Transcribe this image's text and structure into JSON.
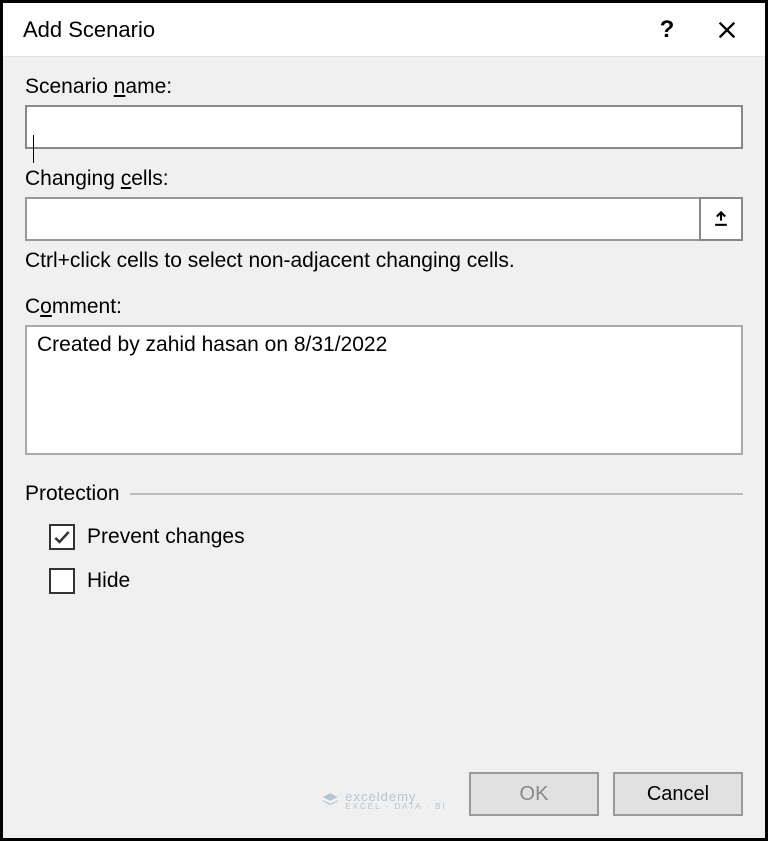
{
  "titlebar": {
    "title": "Add Scenario",
    "help_label": "?"
  },
  "fields": {
    "scenario_name": {
      "label_prefix": "Scenario ",
      "label_ul": "n",
      "label_suffix": "ame:",
      "value": ""
    },
    "changing_cells": {
      "label_prefix": "Changing ",
      "label_ul": "c",
      "label_suffix": "ells:",
      "value": "",
      "hint": "Ctrl+click cells to select non-adjacent changing cells."
    },
    "comment": {
      "label_prefix": "C",
      "label_ul": "o",
      "label_suffix": "mment:",
      "value": "Created by zahid hasan on 8/31/2022"
    }
  },
  "protection": {
    "legend": "Protection",
    "prevent": {
      "checked": true,
      "label_ul": "P",
      "label_suffix": "revent changes"
    },
    "hide": {
      "checked": false,
      "label_prefix": "Hi",
      "label_ul": "d",
      "label_suffix": "e"
    }
  },
  "buttons": {
    "ok": "OK",
    "cancel": "Cancel"
  },
  "watermark": {
    "name": "exceldemy",
    "sub": "EXCEL · DATA · BI"
  }
}
